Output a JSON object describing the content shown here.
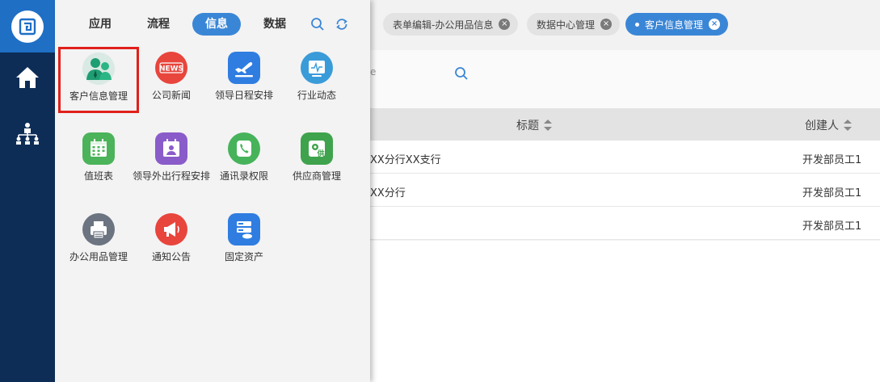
{
  "rail": {
    "items": [
      {
        "icon": "home-icon"
      },
      {
        "icon": "org-chart-icon"
      }
    ]
  },
  "panel": {
    "tabs": [
      {
        "label": "应用"
      },
      {
        "label": "流程"
      },
      {
        "label": "信息",
        "active": true
      },
      {
        "label": "数据"
      }
    ],
    "apps": [
      {
        "label": "客户信息管理",
        "icon": "customer-icon",
        "color": "#1f9d73",
        "selected": true
      },
      {
        "label": "公司新闻",
        "icon": "news-icon",
        "color": "#e8453c"
      },
      {
        "label": "领导日程安排",
        "icon": "airplane-icon",
        "color": "#2f7de1"
      },
      {
        "label": "行业动态",
        "icon": "monitor-icon",
        "color": "#3a9bd9"
      },
      {
        "label": "值班表",
        "icon": "calendar-grid-icon",
        "color": "#4bb35a"
      },
      {
        "label": "领导外出行程安排",
        "icon": "calendar-person-icon",
        "color": "#8a5cc9"
      },
      {
        "label": "通讯录权限",
        "icon": "phone-icon",
        "color": "#46b35b"
      },
      {
        "label": "供应商管理",
        "icon": "supplier-icon",
        "color": "#3fa34d"
      },
      {
        "label": "办公用品管理",
        "icon": "printer-icon",
        "color": "#6b7480"
      },
      {
        "label": "通知公告",
        "icon": "megaphone-icon",
        "color": "#e8453c"
      },
      {
        "label": "固定资产",
        "icon": "server-icon",
        "color": "#2f7de1"
      }
    ],
    "news_badge": "NEWS",
    "supplier_badge": "供"
  },
  "tabs_bar": {
    "tags": [
      {
        "label": "表单编辑-办公用品信息"
      },
      {
        "label": "数据中心管理"
      },
      {
        "label": "客户信息管理",
        "active": true
      }
    ]
  },
  "search": {
    "partial_text": "e"
  },
  "table": {
    "headers": [
      "标题",
      "创建人"
    ],
    "rows": [
      {
        "title": "XX分行XX支行",
        "creator": "开发部员工1"
      },
      {
        "title": "XX分行",
        "creator": "开发部员工1"
      },
      {
        "title": "",
        "creator": "开发部员工1"
      }
    ]
  },
  "colors": {
    "accent": "#3a86d6",
    "rail": "#0d2d57",
    "selection": "#e0201b"
  }
}
